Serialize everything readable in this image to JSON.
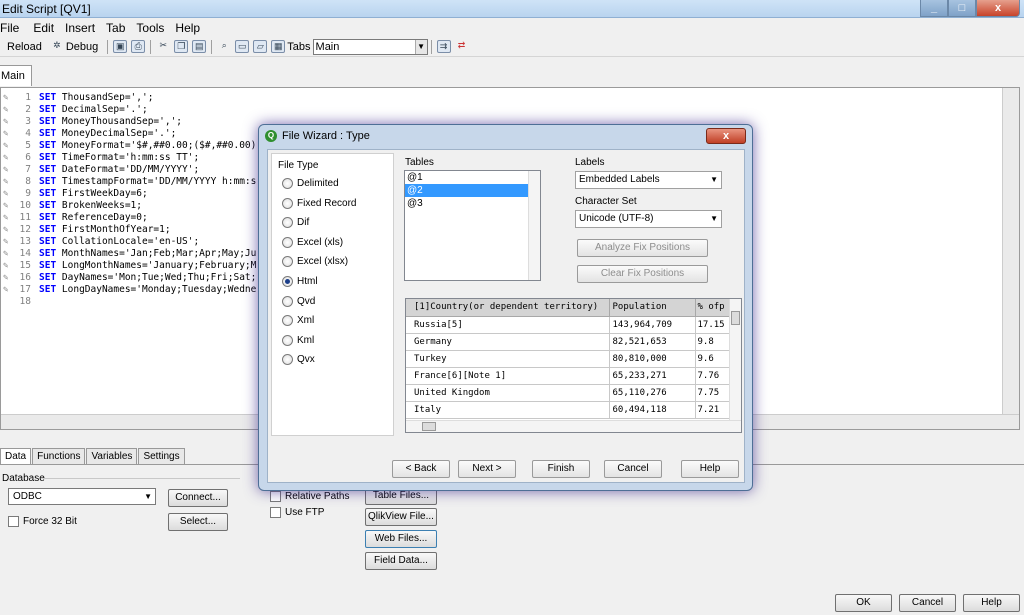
{
  "window": {
    "title": "Edit Script [QV1]",
    "min": "_",
    "max": "□",
    "close": "x"
  },
  "menu": [
    "File",
    "Edit",
    "Insert",
    "Tab",
    "Tools",
    "Help"
  ],
  "toolbar": {
    "reload": "Reload",
    "debug": "Debug",
    "tabs_label": "Tabs",
    "tab_select": "Main"
  },
  "main_tab": "Main",
  "script_lines": [
    {
      "n": "1",
      "kw": "SET",
      "rest": "ThousandSep=',';"
    },
    {
      "n": "2",
      "kw": "SET",
      "rest": "DecimalSep='.';"
    },
    {
      "n": "3",
      "kw": "SET",
      "rest": "MoneyThousandSep=',';"
    },
    {
      "n": "4",
      "kw": "SET",
      "rest": "MoneyDecimalSep='.';"
    },
    {
      "n": "5",
      "kw": "SET",
      "rest": "MoneyFormat='$#,##0.00;($#,##0.00)"
    },
    {
      "n": "6",
      "kw": "SET",
      "rest": "TimeFormat='h:mm:ss TT';"
    },
    {
      "n": "7",
      "kw": "SET",
      "rest": "DateFormat='DD/MM/YYYY';"
    },
    {
      "n": "8",
      "kw": "SET",
      "rest": "TimestampFormat='DD/MM/YYYY h:mm:s"
    },
    {
      "n": "9",
      "kw": "SET",
      "rest": "FirstWeekDay=6;"
    },
    {
      "n": "10",
      "kw": "SET",
      "rest": "BrokenWeeks=1;"
    },
    {
      "n": "11",
      "kw": "SET",
      "rest": "ReferenceDay=0;"
    },
    {
      "n": "12",
      "kw": "SET",
      "rest": "FirstMonthOfYear=1;"
    },
    {
      "n": "13",
      "kw": "SET",
      "rest": "CollationLocale='en-US';"
    },
    {
      "n": "14",
      "kw": "SET",
      "rest": "MonthNames='Jan;Feb;Mar;Apr;May;Ju"
    },
    {
      "n": "15",
      "kw": "SET",
      "rest": "LongMonthNames='January;February;M"
    },
    {
      "n": "16",
      "kw": "SET",
      "rest": "DayNames='Mon;Tue;Wed;Thu;Fri;Sat;"
    },
    {
      "n": "17",
      "kw": "SET",
      "rest": "LongDayNames='Monday;Tuesday;Wedne"
    },
    {
      "n": "18",
      "kw": "",
      "rest": ""
    }
  ],
  "bottom_tabs": [
    "Data",
    "Functions",
    "Variables",
    "Settings"
  ],
  "data_panel": {
    "database_label": "Database",
    "database_value": "ODBC",
    "connect": "Connect...",
    "select": "Select...",
    "force32": "Force 32 Bit",
    "relative_paths": "Relative Paths",
    "use_ftp": "Use FTP",
    "table_files": "Table Files...",
    "qlikview_file": "QlikView File...",
    "web_files": "Web Files...",
    "field_data": "Field Data..."
  },
  "footer": {
    "ok": "OK",
    "cancel": "Cancel",
    "help": "Help"
  },
  "dialog": {
    "title": "File Wizard : Type",
    "close": "x",
    "file_type_label": "File Type",
    "file_types": [
      "Delimited",
      "Fixed Record",
      "Dif",
      "Excel (xls)",
      "Excel (xlsx)",
      "Html",
      "Qvd",
      "Xml",
      "Kml",
      "Qvx"
    ],
    "selected_file_type": "Html",
    "tables_label": "Tables",
    "tables": [
      "@1",
      "@2",
      "@3"
    ],
    "selected_table": "@2",
    "labels_label": "Labels",
    "labels_value": "Embedded Labels",
    "charset_label": "Character Set",
    "charset_value": "Unicode (UTF-8)",
    "analyze_btn": "Analyze Fix Positions",
    "clear_btn": "Clear Fix Positions",
    "grid_headers": [
      "[1]Country(or dependent territory)",
      "Population",
      "% ofp"
    ],
    "grid_rows": [
      [
        "Russia[5]",
        "143,964,709",
        "17.15"
      ],
      [
        "Germany",
        "82,521,653",
        "9.8"
      ],
      [
        "Turkey",
        "80,810,000",
        "9.6"
      ],
      [
        "France[6][Note 1]",
        "65,233,271",
        "7.76"
      ],
      [
        "United Kingdom",
        "65,110,276",
        "7.75"
      ],
      [
        "Italy",
        "60,494,118",
        "7.21"
      ]
    ],
    "back": "< Back",
    "next": "Next >",
    "finish": "Finish",
    "cancel": "Cancel",
    "help": "Help"
  }
}
